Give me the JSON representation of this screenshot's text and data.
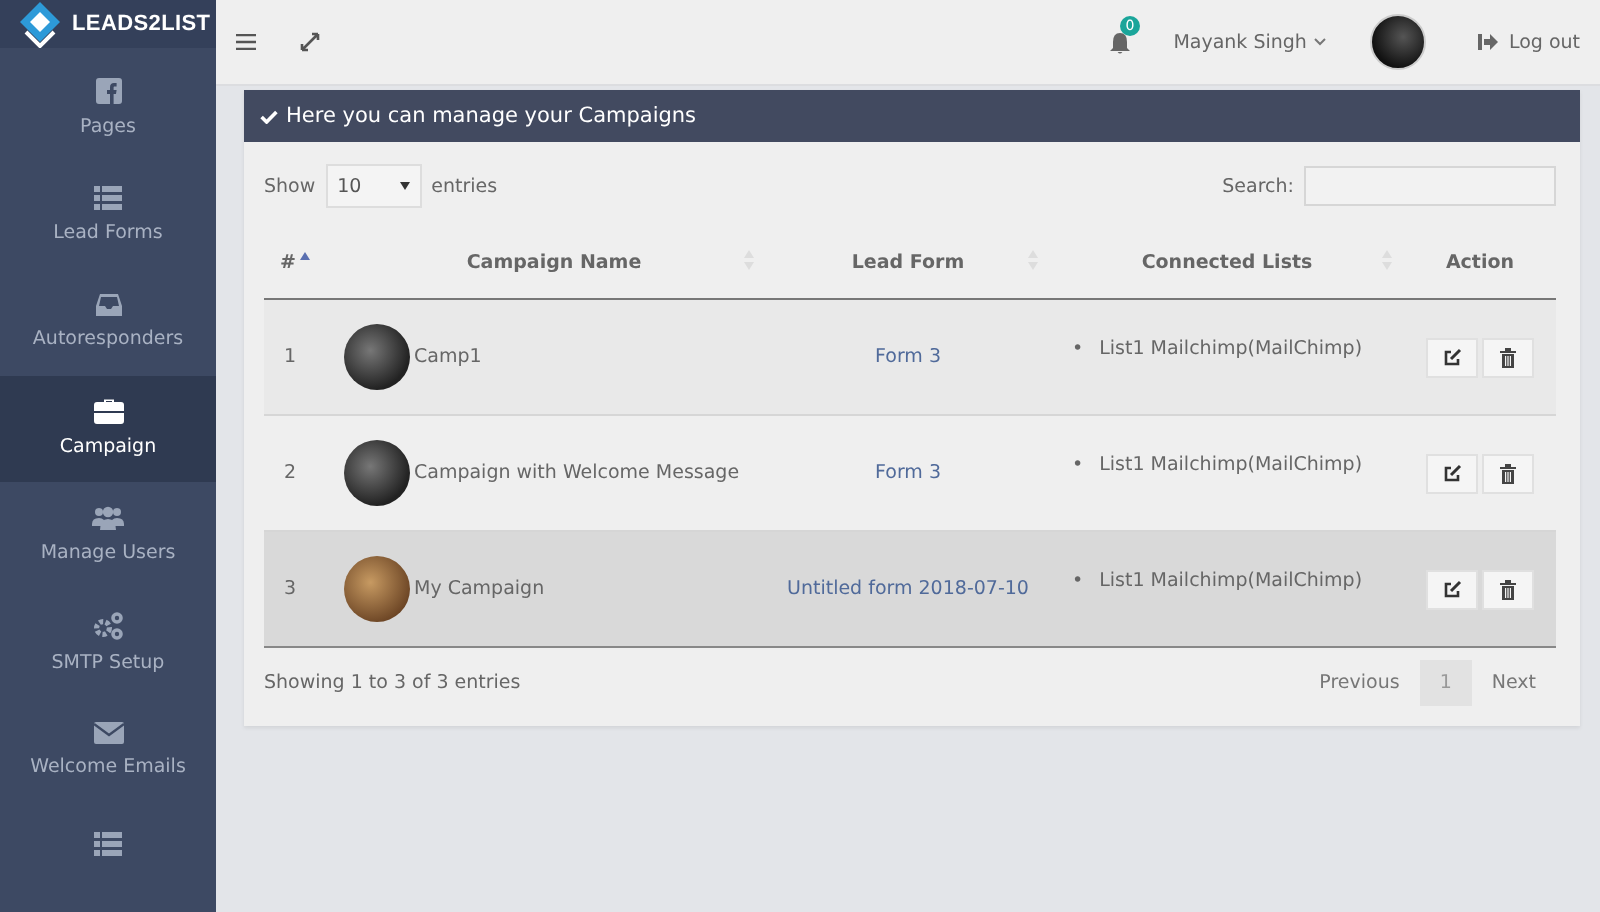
{
  "brand": {
    "name": "LEADS2LIST"
  },
  "sidebar": {
    "items": [
      {
        "label": "Pages",
        "selected": false
      },
      {
        "label": "Lead Forms",
        "selected": false
      },
      {
        "label": "Autoresponders",
        "selected": false
      },
      {
        "label": "Campaign",
        "selected": true
      },
      {
        "label": "Manage Users",
        "selected": false
      },
      {
        "label": "SMTP Setup",
        "selected": false
      },
      {
        "label": "Welcome Emails",
        "selected": false
      }
    ]
  },
  "header": {
    "notification_count": "0",
    "user_name": "Mayank Singh",
    "logout": "Log out"
  },
  "panel": {
    "title": "Here you can manage your Campaigns",
    "length_menu": {
      "prefix": "Show",
      "value": "10",
      "suffix": "entries"
    },
    "search": {
      "label": "Search:"
    },
    "table": {
      "columns": [
        {
          "label": "#",
          "sortable": true,
          "sorted": true
        },
        {
          "label": "Campaign Name",
          "sortable": true,
          "sorted": false
        },
        {
          "label": "Lead Form",
          "sortable": true,
          "sorted": false
        },
        {
          "label": "Connected Lists",
          "sortable": true,
          "sorted": false
        },
        {
          "label": "Action",
          "sortable": false
        }
      ],
      "rows": [
        {
          "number": "1",
          "name": "Camp1",
          "lead_form": "Form 3",
          "lists": [
            {
              "marker": "•",
              "label": "List1 Mailchimp(MailChimp)"
            }
          ],
          "hovered": false
        },
        {
          "number": "2",
          "name": "Campaign with Welcome Message",
          "lead_form": "Form 3",
          "lists": [
            {
              "marker": "•",
              "label": "List1 Mailchimp(MailChimp)"
            }
          ],
          "hovered": false
        },
        {
          "number": "3",
          "name": "My Campaign",
          "lead_form": "Untitled form 2018-07-10",
          "lists": [
            {
              "marker": "•",
              "label": "List1 Mailchimp(MailChimp)"
            }
          ],
          "hovered": true
        }
      ]
    },
    "info": "Showing 1 to 3 of 3 entries",
    "pagination": [
      {
        "label": "Previous",
        "selected": false
      },
      {
        "label": "1",
        "selected": true
      },
      {
        "label": "Next",
        "selected": false
      }
    ]
  }
}
